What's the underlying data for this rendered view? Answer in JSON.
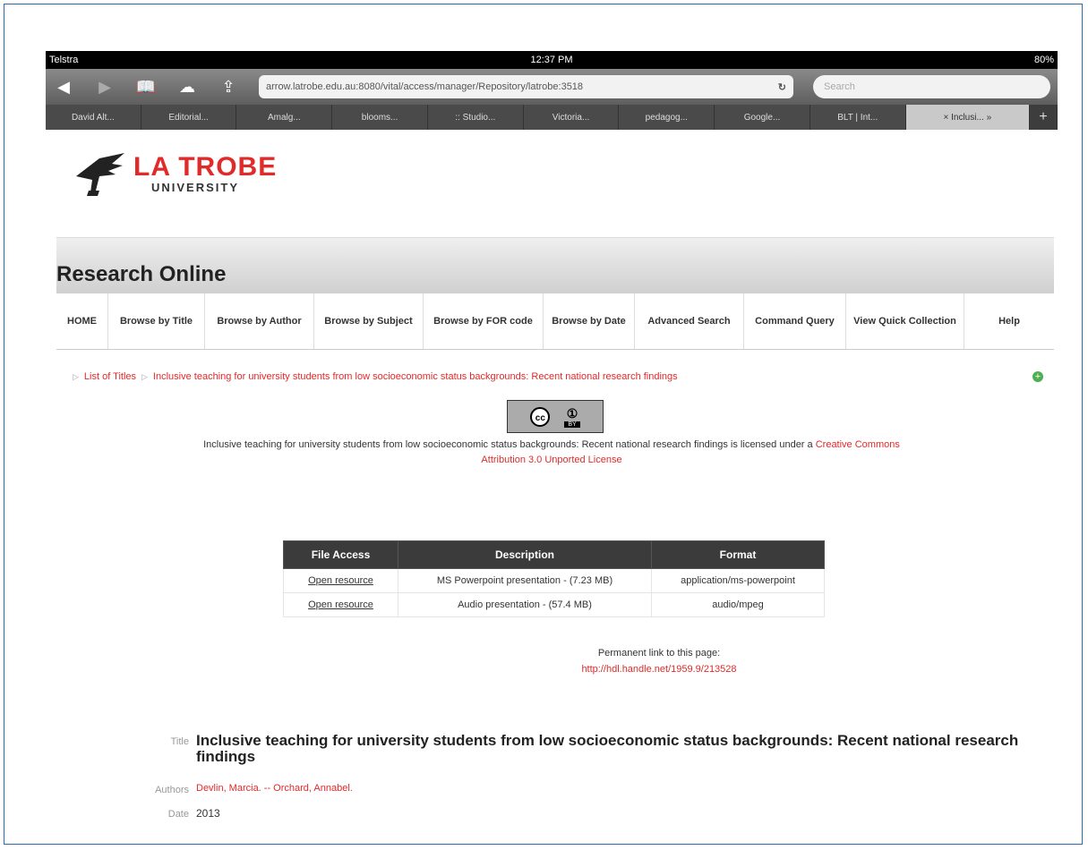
{
  "status_bar": {
    "carrier": "Telstra",
    "time": "12:37 PM",
    "battery": "80%"
  },
  "toolbar": {
    "url": "arrow.latrobe.edu.au:8080/vital/access/manager/Repository/latrobe:3518",
    "search_placeholder": "Search"
  },
  "tabs": [
    "David Alt...",
    "Editorial...",
    "Amalg...",
    "blooms...",
    ":: Studio...",
    "Victoria...",
    "pedagog...",
    "Google...",
    "BLT | Int...",
    "Inclusi..."
  ],
  "logo": {
    "line1": "LA TROBE",
    "line2": "UNIVERSITY"
  },
  "header_title": "Research Online",
  "nav": [
    "HOME",
    "Browse by Title",
    "Browse by Author",
    "Browse by Subject",
    "Browse by FOR code",
    "Browse by Date",
    "Advanced Search",
    "Command Query",
    "View Quick Collection",
    "Help"
  ],
  "breadcrumb": {
    "item1": "List of Titles",
    "item2": "Inclusive teaching for university students from low socioeconomic status backgrounds: Recent national research findings"
  },
  "cc": {
    "cc_symbol": "cc",
    "by_symbol": "①",
    "by_label": "BY"
  },
  "license": {
    "text": "Inclusive teaching for university students from low socioeconomic status backgrounds: Recent national research findings is licensed under a",
    "link1": "Creative Commons",
    "link2": "Attribution 3.0 Unported License"
  },
  "files": {
    "headers": [
      "File Access",
      "Description",
      "Format"
    ],
    "rows": [
      {
        "access": "Open resource",
        "description": "MS Powerpoint presentation - (7.23 MB)",
        "format": "application/ms-powerpoint"
      },
      {
        "access": "Open resource",
        "description": "Audio presentation - (57.4 MB)",
        "format": "audio/mpeg"
      }
    ]
  },
  "permalink": {
    "label": "Permanent link to this page:",
    "url": "http://hdl.handle.net/1959.9/213528"
  },
  "metadata": {
    "title_label": "Title",
    "title": "Inclusive teaching for university students from low socioeconomic status backgrounds: Recent national research findings",
    "authors_label": "Authors",
    "authors": "Devlin, Marcia. -- Orchard, Annabel.",
    "date_label": "Date",
    "date": "2013"
  }
}
